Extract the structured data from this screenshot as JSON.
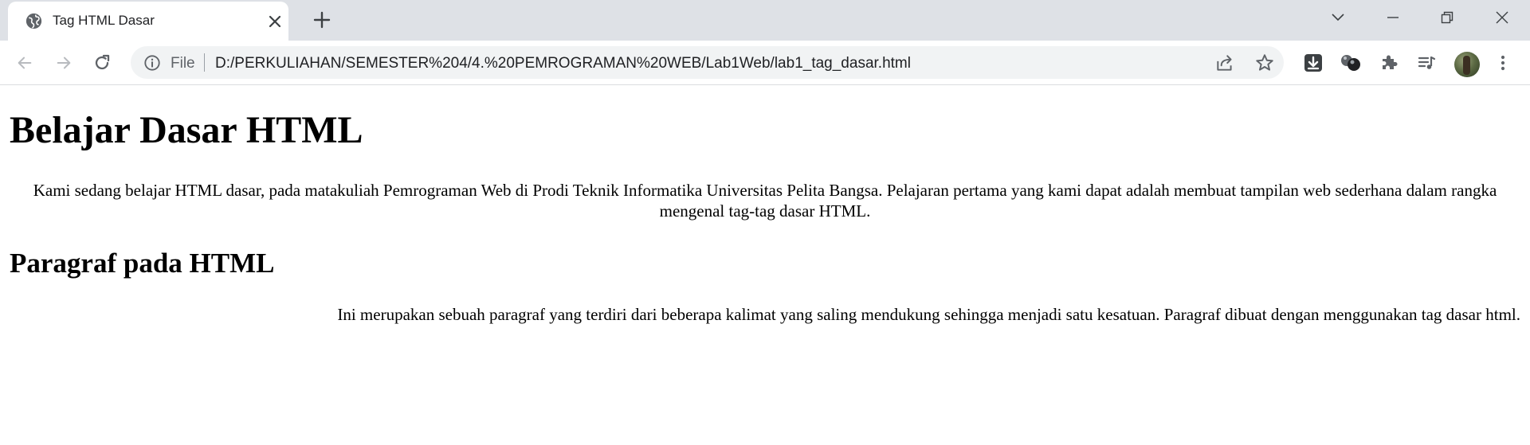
{
  "browser": {
    "tab": {
      "title": "Tag HTML Dasar"
    },
    "omnibox": {
      "scheme_label": "File",
      "url": "D:/PERKULIAHAN/SEMESTER%204/4.%20PEMROGRAMAN%20WEB/Lab1Web/lab1_tag_dasar.html"
    },
    "icons": {
      "tab": "globe-icon",
      "close": "close-icon",
      "new_tab": "plus-icon",
      "tab_search": "chevron-down-icon",
      "minimize": "minimize-icon",
      "restore": "restore-icon",
      "window_close": "window-close-icon",
      "back": "back-arrow-icon",
      "forward": "forward-arrow-icon",
      "reload": "reload-icon",
      "info": "info-icon",
      "share": "share-icon",
      "bookmark": "star-icon",
      "extensions": [
        "download-extension-icon",
        "spheres-extension-icon",
        "puzzle-icon",
        "media-queue-icon"
      ],
      "profile": "avatar",
      "menu": "kebab-menu-icon"
    }
  },
  "page": {
    "heading1": "Belajar Dasar HTML",
    "paragraph1": "Kami sedang belajar HTML dasar, pada matakuliah Pemrograman Web di Prodi Teknik Informatika Universitas Pelita Bangsa. Pelajaran pertama yang kami dapat adalah membuat tampilan web sederhana dalam rangka mengenal tag-tag dasar HTML.",
    "heading2": "Paragraf pada HTML",
    "paragraph2": "Ini merupakan sebuah paragraf yang terdiri dari beberapa kalimat yang saling mendukung sehingga menjadi satu kesatuan. Paragraf dibuat dengan menggunakan tag dasar html."
  }
}
